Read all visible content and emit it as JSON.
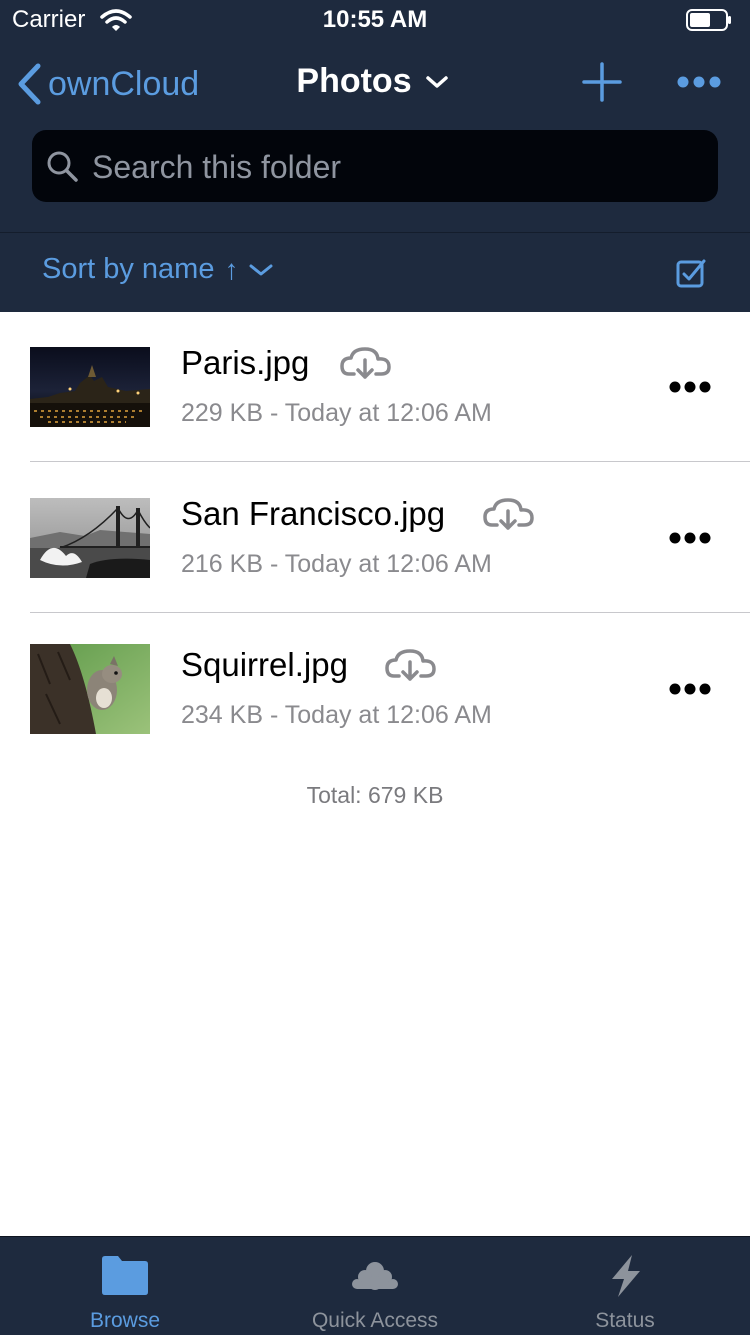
{
  "status_bar": {
    "carrier": "Carrier",
    "time": "10:55 AM"
  },
  "nav": {
    "back_label": "ownCloud",
    "title": "Photos",
    "icons": {
      "back": "chevron-left-icon",
      "title": "chevron-down-icon",
      "add": "plus-icon",
      "more": "more-icon"
    }
  },
  "search": {
    "placeholder": "Search this folder",
    "icon": "search-icon"
  },
  "sort": {
    "label": "Sort by name",
    "direction_glyph": "↑",
    "select_icon": "checkbox-icon"
  },
  "files": [
    {
      "name": "Paris.jpg",
      "meta": "229 KB - Today at 12:06 AM",
      "status_icon": "cloud-download-icon",
      "action_icon": "more-icon"
    },
    {
      "name": "San Francisco.jpg",
      "meta": "216 KB - Today at 12:06 AM",
      "status_icon": "cloud-download-icon",
      "action_icon": "more-icon"
    },
    {
      "name": "Squirrel.jpg",
      "meta": "234 KB - Today at 12:06 AM",
      "status_icon": "cloud-download-icon",
      "action_icon": "more-icon"
    }
  ],
  "total": "Total: 679 KB",
  "tabs": [
    {
      "label": "Browse",
      "icon": "folder-icon",
      "active": true
    },
    {
      "label": "Quick Access",
      "icon": "cloud-icon",
      "active": false
    },
    {
      "label": "Status",
      "icon": "lightning-icon",
      "active": false
    }
  ],
  "colors": {
    "header_bg": "#1e2a3e",
    "accent": "#5b9ce0",
    "search_bg": "#02050b",
    "meta_text": "#8a8a8e",
    "tab_inactive": "#8d939c"
  }
}
